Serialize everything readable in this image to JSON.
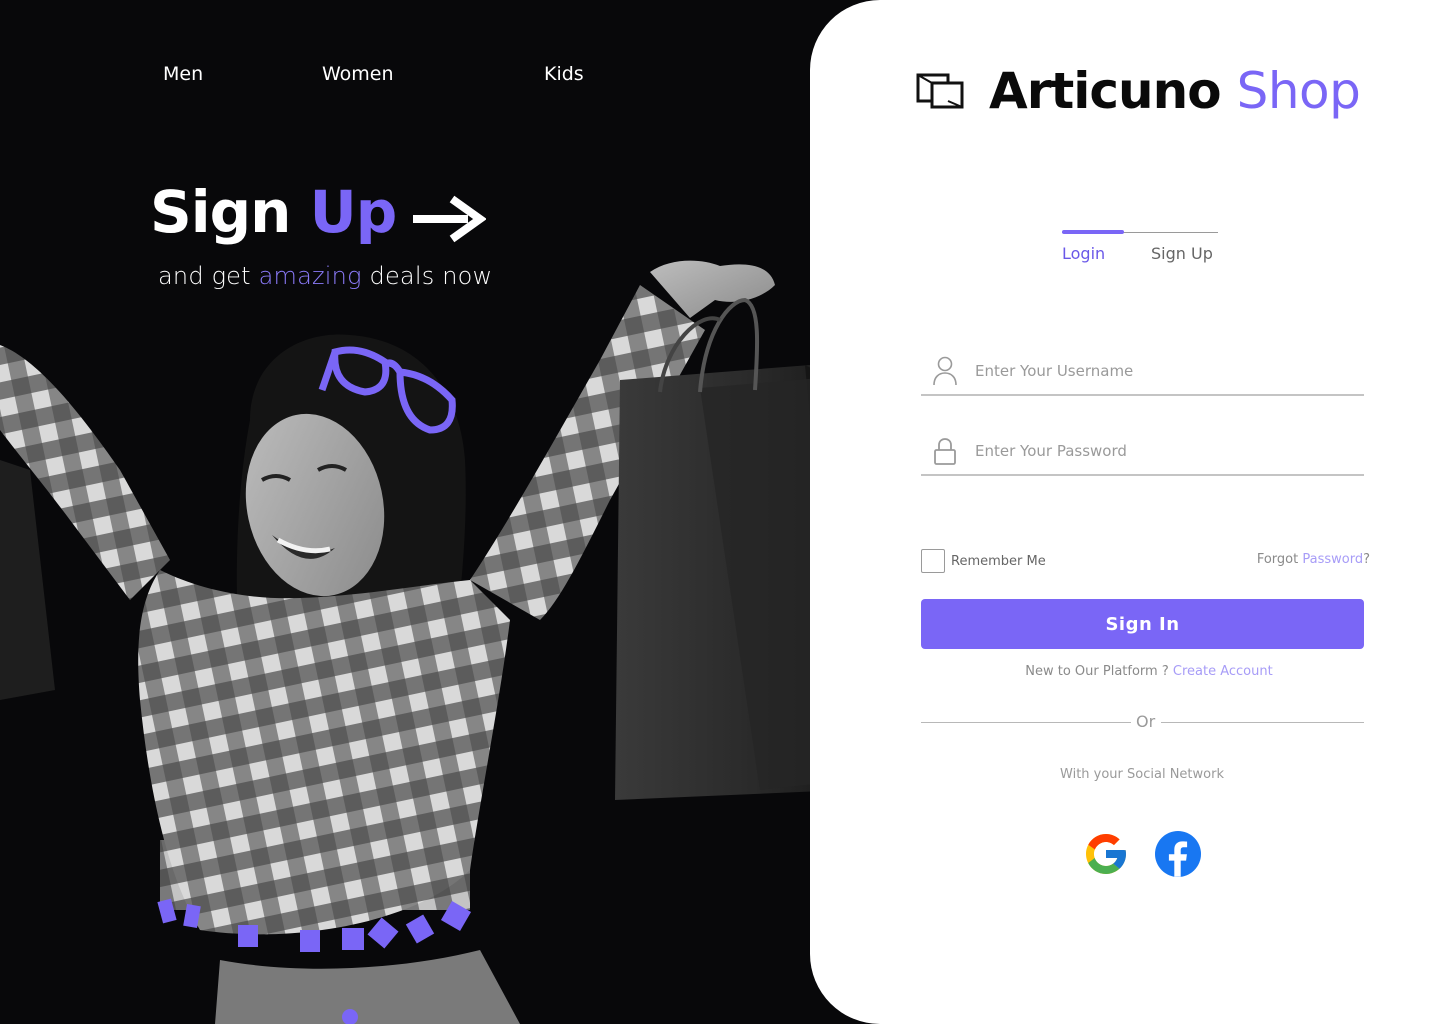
{
  "nav": {
    "items": [
      {
        "label": "Men"
      },
      {
        "label": "Women"
      },
      {
        "label": "Kids"
      }
    ]
  },
  "hero": {
    "title_main": "Sign",
    "title_accent": "Up",
    "subtitle_before": "and get",
    "subtitle_accent": "amazing",
    "subtitle_after": "deals now",
    "arrow_icon": "arrow-right-icon"
  },
  "brand": {
    "name": "Articuno",
    "shop": "Shop",
    "logo_icon": "shop-logo-icon"
  },
  "tabs": [
    {
      "label": "Login",
      "active": true
    },
    {
      "label": "Sign Up",
      "active": false
    }
  ],
  "form": {
    "username": {
      "placeholder": "Enter Your Username",
      "value": "",
      "icon": "user-icon"
    },
    "password": {
      "placeholder": "Enter Your Password",
      "value": "",
      "icon": "lock-icon"
    },
    "remember_label": "Remember Me",
    "remember_checked": false,
    "forgot_prefix": "Forgot",
    "forgot_link": "Password",
    "forgot_suffix": "?",
    "submit_label": "Sign In",
    "new_prefix": "New to Our Platform ?",
    "create_link": "Create Account",
    "or_label": "Or",
    "social_label": "With your Social Network"
  },
  "social": [
    {
      "name": "Google",
      "icon": "google-icon"
    },
    {
      "name": "Facebook",
      "icon": "facebook-icon"
    }
  ],
  "colors": {
    "accent": "#7a66f6",
    "background_dark": "#08080a",
    "panel": "#ffffff"
  }
}
